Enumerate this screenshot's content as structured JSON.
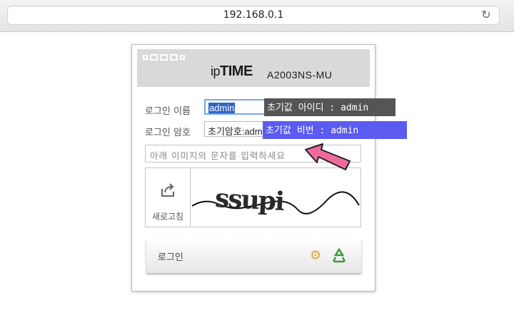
{
  "browser": {
    "url": "192.168.0.1",
    "reload_icon": "reload-icon"
  },
  "header": {
    "brand_ip": "ip",
    "brand_time": "TIME",
    "model": "A2003NS-MU"
  },
  "form": {
    "username_label": "로그인 이름",
    "username_value": "admin",
    "password_label": "로그인 암호",
    "password_placeholder": "초기암호:admin",
    "captcha_placeholder": "아래 이미지의 문자를 입력하세요",
    "refresh_label": "새로고침",
    "captcha_text": "ssupi",
    "login_label": "로그인"
  },
  "tooltips": {
    "default_id": "초기값 아이디 : admin",
    "default_pw": "초기값 비번 : admin"
  },
  "colors": {
    "tooltip_id_bg": "#555555",
    "tooltip_pw_bg": "#5b5bf2",
    "arrow": "#f06aa0"
  }
}
